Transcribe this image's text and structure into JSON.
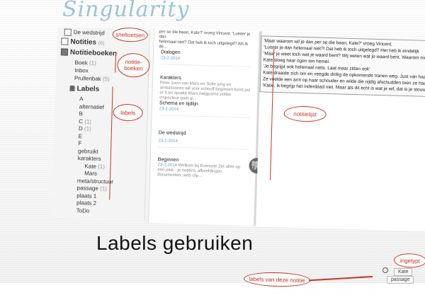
{
  "logo": "Singularity",
  "sidebar": {
    "shortcut_item": "De wedstrijd",
    "notes": "Notities",
    "notes_count": "(6)",
    "notebooks": "Notitieboeken",
    "notebook_items": [
      {
        "label": "Boek",
        "count": "(1)"
      },
      {
        "label": "Inbox",
        "count": ""
      },
      {
        "label": "Prullenbak",
        "count": "(5)"
      }
    ],
    "labels": "Labels",
    "label_items": [
      "A",
      "alternatief",
      "B",
      "C",
      "D",
      "E",
      "F",
      "gebruikt",
      "karakters",
      "Kate",
      "Mars",
      "meta/structuur",
      "passage",
      "plaats 1",
      "plaats 2",
      "ToDo"
    ],
    "label_counts": {
      "C": "(1)",
      "D": "(1)",
      "Kate": "(1)",
      "passage": "(1)"
    }
  },
  "notelist": {
    "header_lines": [
      "per se die baan, Kate?' vroeg Vincent. 'Luister je dan",
      "helemaal niet? Dat heb ik toch uitgelegd? Als ik de..."
    ],
    "cards": [
      {
        "title": "Dialogen",
        "date": "23-2-2014",
        "snippet": ""
      },
      {
        "title": "Karakters",
        "date": "23-2-2014",
        "snippet": "Peter zoon van Mars en Sofie jong en ambassonen wil voor schoolf beginnen komt pui or 8 ter sprake Mars zwijgzame politie inspecteur gaat gi..."
      },
      {
        "title": "Schema en tijdlijn",
        "date": "23-2-2014",
        "snippet": ""
      },
      {
        "title": "De wedstrijd",
        "date": "23-2-2014",
        "snippet": ""
      },
      {
        "title": "Beginnen",
        "date": "23-2-2014",
        "snippet": "Welkom bij Evernote Zet alles op een plek - je notities, afbeeldingen, documenten, web clip..."
      }
    ]
  },
  "editor": {
    "lines": [
      "'Maar waarom wil je dan per se die baan, Kate?' vroeg Vincent.",
      "'Luister je dan helemaal niet?! Dat heb ik toch uitgelegd? Het heb ik eindelijk",
      "'Maar je weet toch wat je waard bent? Wij weten wat je waard bent. Waarom moet je ze",
      "Kate sloeg haar ogen ten hemel.",
      "'Je begrijpt ook helemaal niets. Laat maar zitten ook'",
      "Kate draaide zich om en veegde driftig de opkomende tranen weg. Just van haar kever",
      "Ze voelde een arm op haar schouder en wilde die nijdig afschudden toen ze haar broer",
      "'Katie, ik begrijp het inderdaad niet. Maar als dit echt is wat je wil, dat is je stouwen.'"
    ]
  },
  "heading": "Labels gebruiken",
  "tagbar": {
    "tags": [
      "Kate",
      "passage"
    ]
  },
  "annotations": {
    "shortcuts": "sneltoetsen",
    "notebooks": "notitie-\nboeken",
    "labels": "labels",
    "notelist": "notitielijst",
    "note_labels": "labels van deze notitie",
    "input": "ingetypt"
  },
  "colors": {
    "annotation": "#c0392b",
    "logo": "#9dc3d6",
    "date": "#6aa0c4"
  }
}
